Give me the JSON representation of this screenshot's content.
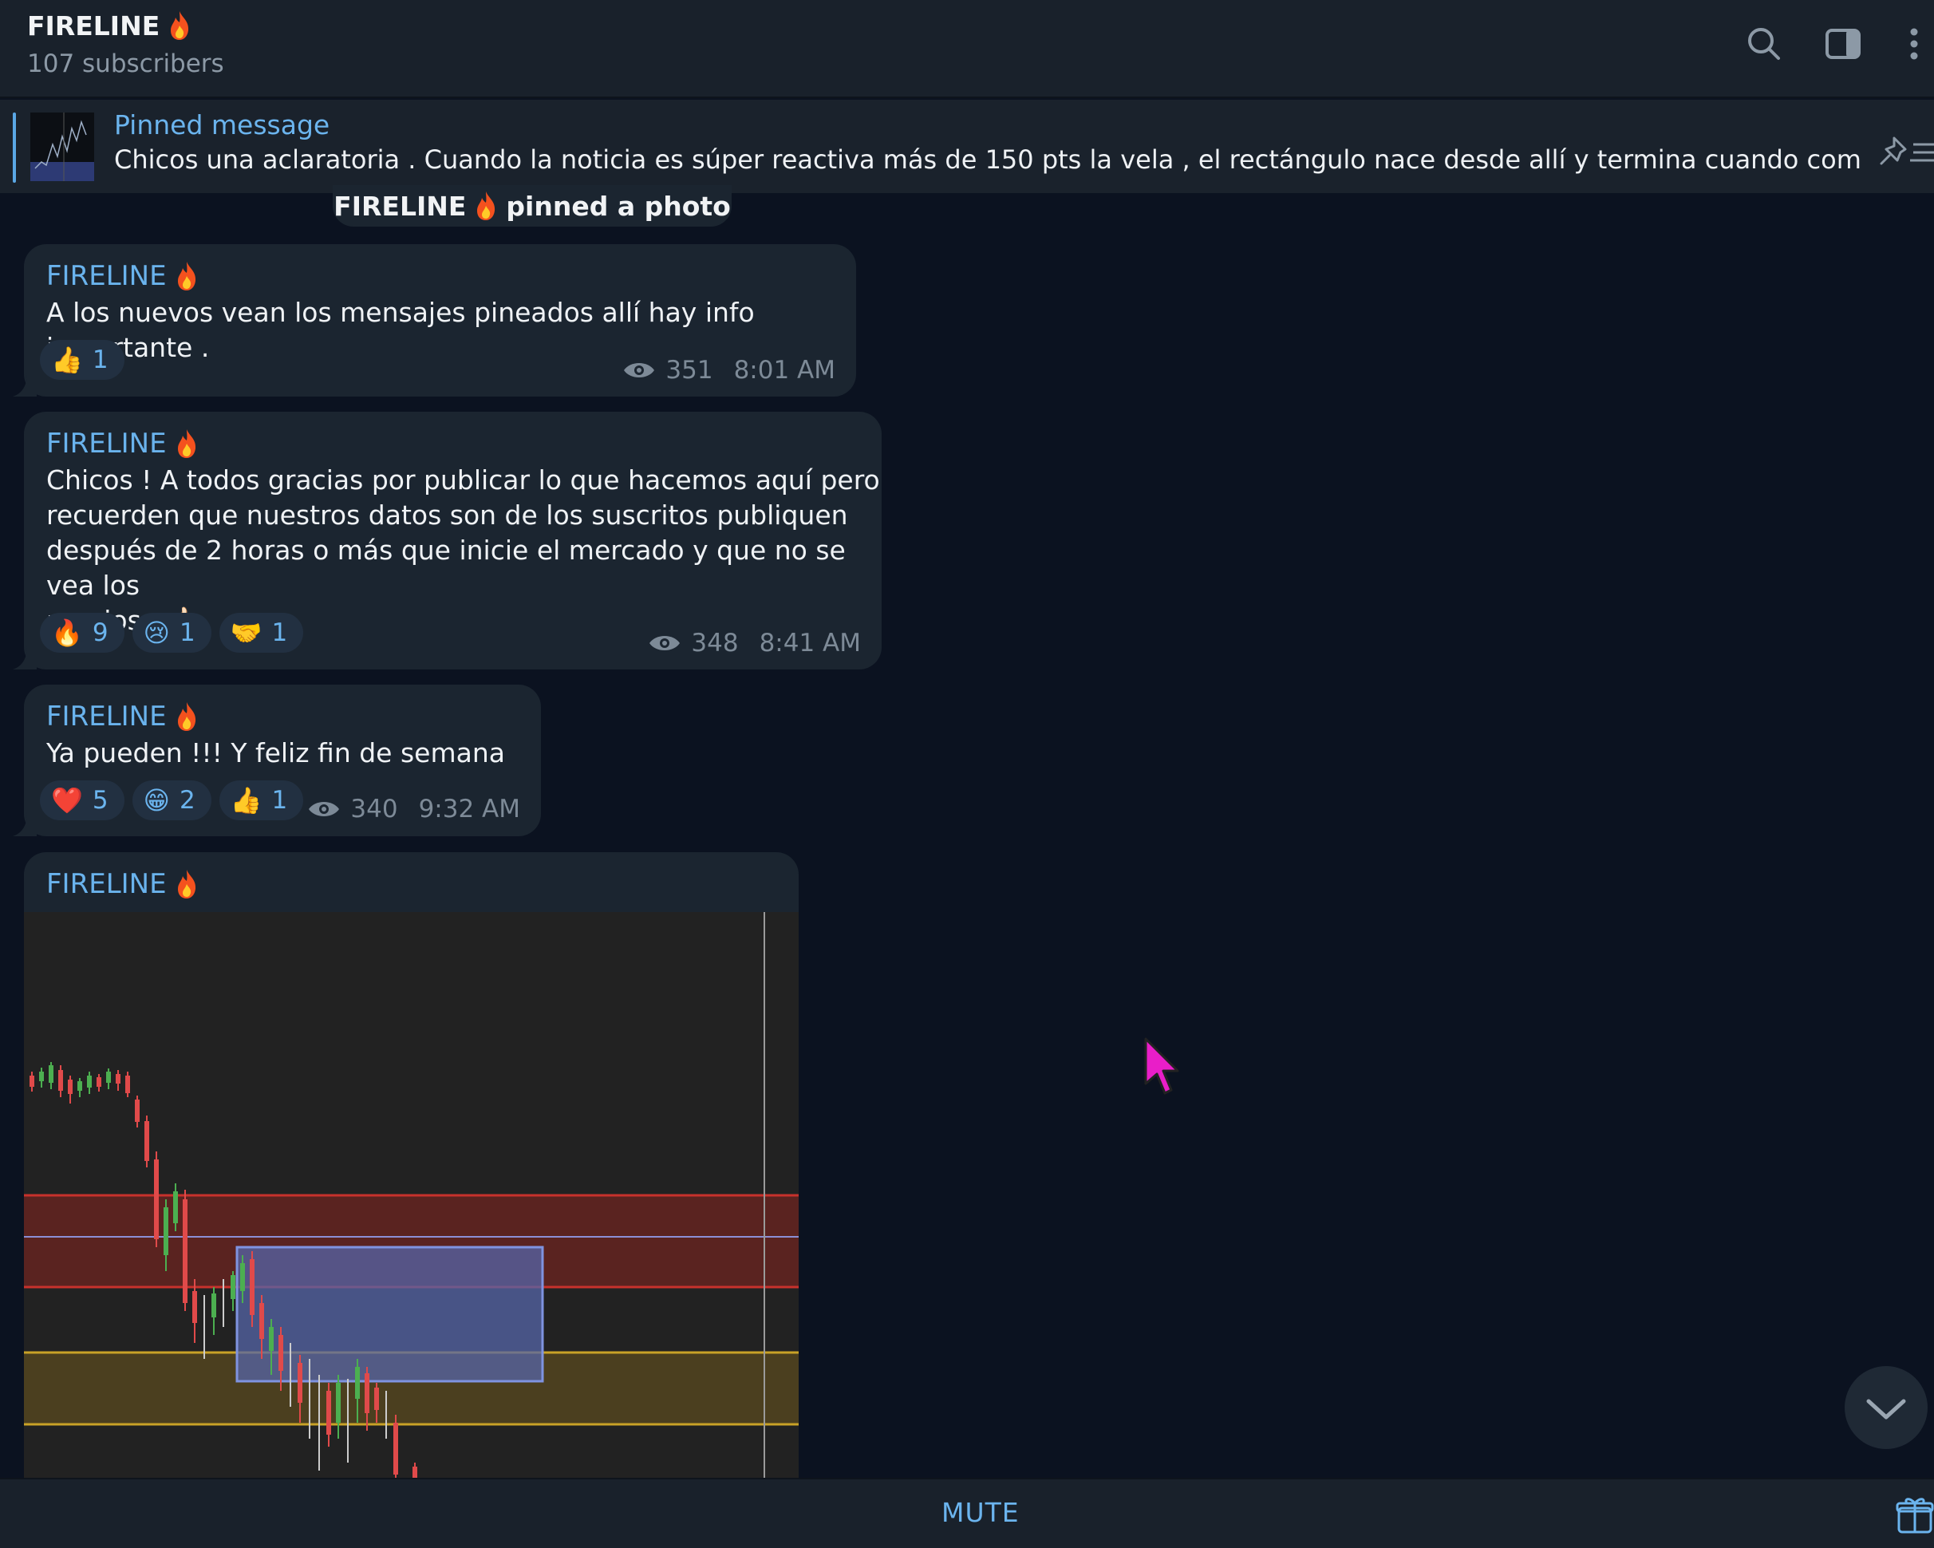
{
  "channel": {
    "title": "FIRELINE",
    "subscribers": "107 subscribers"
  },
  "header_icons": [
    "search-icon",
    "sidebar-toggle-icon",
    "more-vertical-icon"
  ],
  "pinned": {
    "label": "Pinned message",
    "text": "Chicos una aclaratoria .  Cuando la noticia es súper reactiva más de 150 pts la vela , el rectángulo nace desde allí y termina cuando complete las..."
  },
  "service": {
    "author": "FIRELINE",
    "action": "pinned a photo"
  },
  "messages": [
    {
      "author": "FIRELINE",
      "lines": [
        "A los nuevos vean los mensajes pineados allí hay info importante ."
      ],
      "reactions": [
        {
          "emoji": "👍",
          "count": "1"
        }
      ],
      "views": "351",
      "time": "8:01 AM"
    },
    {
      "author": "FIRELINE",
      "lines": [
        "Chicos ! A todos gracias por publicar lo que hacemos aquí pero",
        "recuerden que nuestros datos son de los suscritos publiquen",
        "después de 2 horas o más que inicie el mercado y que no se vea los",
        "precios . 👍🏻"
      ],
      "reactions": [
        {
          "emoji": "🔥",
          "count": "9"
        },
        {
          "emoji": "😢",
          "count": "1"
        },
        {
          "emoji": "🤝",
          "count": "1"
        }
      ],
      "views": "348",
      "time": "8:41 AM"
    },
    {
      "author": "FIRELINE",
      "lines": [
        "Ya pueden !!! Y feliz fin de semana"
      ],
      "reactions": [
        {
          "emoji": "❤️",
          "count": "5"
        },
        {
          "emoji": "😁",
          "count": "2"
        },
        {
          "emoji": "👍",
          "count": "1"
        }
      ],
      "views": "340",
      "time": "9:32 AM"
    },
    {
      "author": "FIRELINE"
    }
  ],
  "footer": {
    "mute": "MUTE"
  },
  "colors": {
    "background": "#0b1220",
    "bubble": "#1b2530",
    "accent": "#6ab3ed"
  }
}
